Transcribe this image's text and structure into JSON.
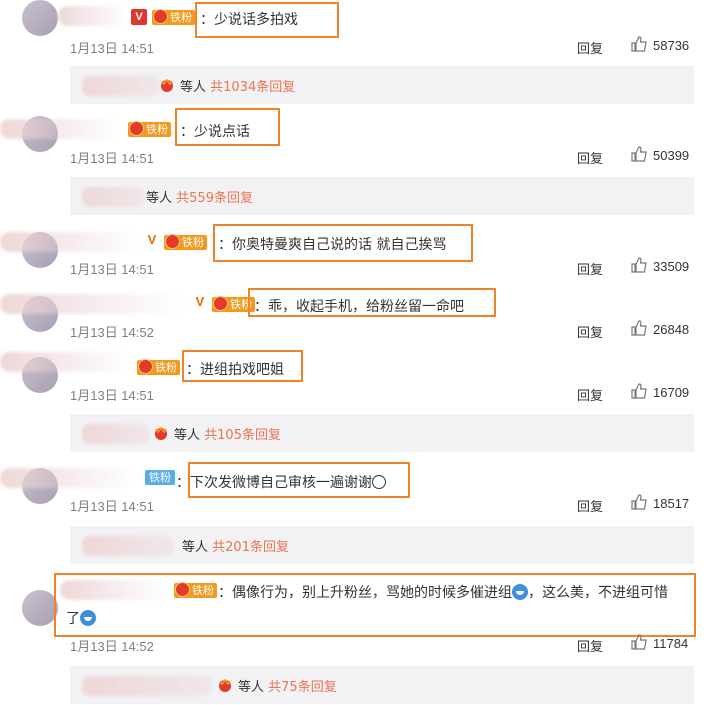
{
  "comments": [
    {
      "text": "：少说话多拍戏",
      "time": "1月13日 14:51",
      "reply": "回复",
      "likes": "58736",
      "badge": "铁粉"
    },
    {
      "text": "：少说点话",
      "time": "1月13日 14:51",
      "reply": "回复",
      "likes": "50399",
      "badge": "铁粉"
    },
    {
      "text": "：你奥特曼爽自己说的话 就自己挨骂",
      "time": "1月13日 14:51",
      "reply": "回复",
      "likes": "33509",
      "badge": "铁粉"
    },
    {
      "text": "：乖，收起手机，给粉丝留一命吧",
      "time": "1月13日 14:52",
      "reply": "回复",
      "likes": "26848",
      "badge": "铁粉"
    },
    {
      "text": "：进组拍戏吧姐",
      "time": "1月13日 14:51",
      "reply": "回复",
      "likes": "16709",
      "badge": "铁粉"
    },
    {
      "text": "：下次发微博自己审核一遍谢谢",
      "time": "1月13日 14:51",
      "reply": "回复",
      "likes": "18517",
      "badge": "铁粉"
    },
    {
      "text_line1": "：偶像行为，别上升粉丝，骂她的时候多催进组",
      "text_line1b": "，这么美，不进组可惜",
      "text_line2": "了",
      "time": "1月13日 14:52",
      "reply": "回复",
      "likes": "11784",
      "badge": "铁粉"
    }
  ],
  "subreplies": [
    {
      "prefix": "等人",
      "link": "共1034条回复"
    },
    {
      "prefix": "等人",
      "link": "共559条回复"
    },
    {
      "prefix": "等人",
      "link": "共105条回复"
    },
    {
      "prefix": "等人",
      "link": "共201条回复"
    },
    {
      "prefix": "等人",
      "link": "共75条回复"
    }
  ],
  "colors": {
    "highlight": "#f08228",
    "link": "#eb7350",
    "fan_badge": "#f39a1e"
  },
  "icons": {
    "like": "thumbs-up-icon",
    "verified": "v-verified-icon",
    "fan": "fan-badge-icon"
  }
}
